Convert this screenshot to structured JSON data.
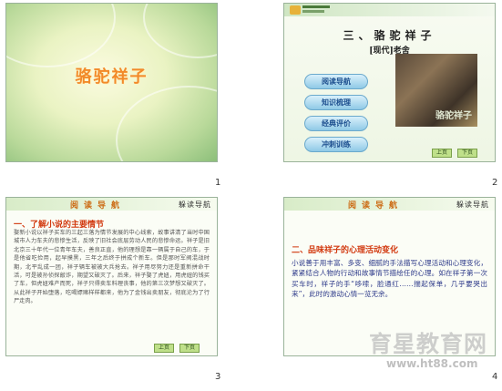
{
  "slides": [
    {
      "number": "1",
      "title": "骆驼祥子"
    },
    {
      "number": "2",
      "heading": "三、骆驼祥子",
      "author": "[现代]老舍",
      "menu": [
        "阅读导航",
        "知识梳理",
        "经典评价",
        "冲刺训练"
      ],
      "photo_caption": "骆驼祥子",
      "nav_prev": "上页",
      "nav_next": "下页"
    },
    {
      "number": "3",
      "header_title": "阅读导航",
      "header_right": "躲读导航",
      "section": "一、了解小说的主要情节",
      "body": "   娶新小说以祥子买车的三起三落为情节发展的中心线索，故事讲清了当时中国城市人力车夫的悲惨生活，反映了旧社会底层劳动人民的悲惨命运。祥子是旧北京三十年代一位青年车夫，善良正直，他的理想是靠一辆属于自己的车，于是他省吃俭用，起早摸黑，三年之后终于拼成个新车。但是那时军阀混战时期，北平乱成一团，祥子辆车被被大兵抢去。祥子用尽努力还是重新拼命干活，可是被孙侦探敲诈，期望又破灭了。后来，祥子娶了虎妞，用虎妞的钱买了车，但虎妞难产而死，祥子只得卖车料理丧事，他的第三次梦想又破灭了。从此祥子开始堕落，吃喝嫖赌样样都来，他为了金钱出卖朋友，彻底沦为了行尸走肉。",
      "nav_prev": "上页",
      "nav_next": "下页"
    },
    {
      "number": "4",
      "header_title": "阅读导航",
      "header_right": "躲读导航",
      "section": "二、品味祥子的心理活动变化",
      "body": "   小说善于用丰富、多变、细腻的手法描写心理活动和心理变化，紧紧结合人物的行动和故事情节描绘任的心理。如在祥子第一次买车时，祥子的手“哆嗦，脸通红……揣起保单，几乎要哭出来”，此时的激动心情一览无余。"
    }
  ],
  "watermark": {
    "main": "育星教育网",
    "url": "www.ht88.com"
  }
}
